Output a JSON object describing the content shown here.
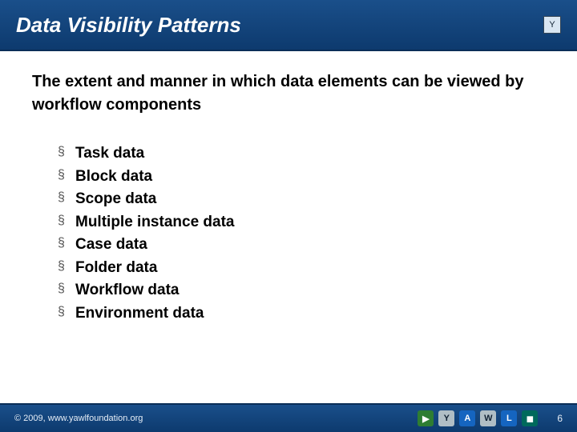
{
  "header": {
    "title": "Data Visibility Patterns",
    "logo_text": "Y"
  },
  "content": {
    "subtitle": "The extent and manner in which data elements can be viewed by workflow components",
    "bullets": [
      "Task data",
      "Block data",
      "Scope data",
      "Multiple instance data",
      "Case data",
      "Folder data",
      "Workflow data",
      "Environment data"
    ]
  },
  "footer": {
    "copyright": "© 2009, www.yawlfoundation.org",
    "page_number": "6",
    "logo_letters": [
      "▶",
      "Y",
      "A",
      "W",
      "L",
      "◼"
    ]
  }
}
